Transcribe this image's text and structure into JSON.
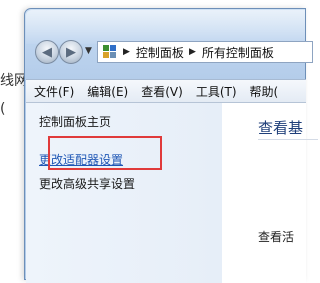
{
  "background_window": {
    "text_line1": "线网",
    "text_line2": "("
  },
  "navigation": {
    "back_icon": "arrow-left-icon",
    "forward_icon": "arrow-right-icon",
    "breadcrumb": [
      "控制面板",
      "所有控制面板"
    ],
    "separator": "▶"
  },
  "menubar": {
    "items": [
      "文件(F)",
      "编辑(E)",
      "查看(V)",
      "工具(T)",
      "帮助("
    ]
  },
  "left_pane": {
    "home": "控制面板主页",
    "link_adapter": "更改适配器设置",
    "link_sharing": "更改高级共享设置"
  },
  "right_pane": {
    "title": "查看基",
    "text": "查看活"
  },
  "colors": {
    "highlight": "#e03a3a",
    "link": "#1f57b5",
    "title": "#1f3f7a"
  }
}
